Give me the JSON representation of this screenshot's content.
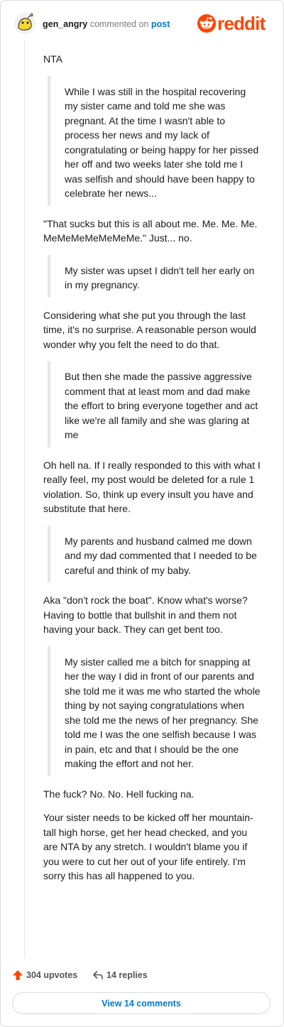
{
  "comment": {
    "username": "gen_angry",
    "action_text": "commented on",
    "target_text": "post",
    "brand": "reddit",
    "paragraphs": [
      {
        "type": "text",
        "text": "NTA"
      },
      {
        "type": "quote",
        "text": "While I was still in the hospital recovering my sister came and told me she was pregnant. At the time I wasn't able to process her news and my lack of congratulating or being happy for her pissed her off and two weeks later she told me I was selfish and should have been happy to celebrate her news..."
      },
      {
        "type": "text",
        "text": "\"That sucks but this is all about me. Me. Me. Me. MeMeMeMeMeMeMe.\" Just... no."
      },
      {
        "type": "quote",
        "text": "My sister was upset I didn't tell her early on in my pregnancy."
      },
      {
        "type": "text",
        "text": "Considering what she put you through the last time, it's no surprise. A reasonable person would wonder why you felt the need to do that."
      },
      {
        "type": "quote",
        "text": "But then she made the passive aggressive comment that at least mom and dad make the effort to bring everyone together and act like we're all family and she was glaring at me"
      },
      {
        "type": "text",
        "text": "Oh hell na. If I really responded to this with what I really feel, my post would be deleted for a rule 1 violation. So, think up every insult you have and substitute that here."
      },
      {
        "type": "quote",
        "text": "My parents and husband calmed me down and my dad commented that I needed to be careful and think of my baby."
      },
      {
        "type": "text",
        "text": "Aka \"don't rock the boat\". Know what's worse? Having to bottle that bullshit in and them not having your back. They can get bent too."
      },
      {
        "type": "quote",
        "text": "My sister called me a bitch for snapping at her the way I did in front of our parents and she told me it was me who started the whole thing by not saying congratulations when she told me the news of her pregnancy. She told me I was the one selfish because I was in pain, etc and that I should be the one making the effort and not her."
      },
      {
        "type": "text",
        "text": "The fuck? No. No. Hell fucking na."
      },
      {
        "type": "text",
        "text": "Your sister needs to be kicked off her mountain-tall high horse, get her head checked, and you are NTA by any stretch. I wouldn't blame you if you were to cut her out of your life entirely. I'm sorry this has all happened to you."
      }
    ],
    "upvotes_label": "304 upvotes",
    "replies_label": "14 replies",
    "view_comments_label": "View 14 comments"
  },
  "icons": {
    "avatar": "snoo-avatar-yellow",
    "logo": "reddit-snoo-icon",
    "upvote": "upvote-arrow-icon",
    "reply": "reply-arrow-icon"
  },
  "colors": {
    "brand": "#ff4500",
    "link": "#0079d3",
    "quote_bar": "#e6e6e6",
    "avatar_yellow": "#f5d835"
  }
}
